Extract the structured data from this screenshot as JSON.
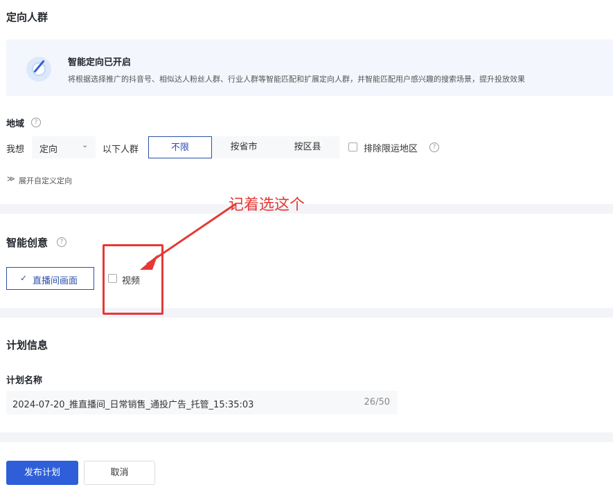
{
  "targeting": {
    "title": "定向人群",
    "banner": {
      "title": "智能定向已开启",
      "desc": "将根据选择推广的抖音号、相似达人粉丝人群、行业人群等智能匹配和扩展定向人群，并智能匹配用户感兴趣的搜索场景，提升投放效果"
    }
  },
  "region": {
    "label": "地域",
    "prefix": "我想",
    "mode_value": "定向",
    "suffix": "以下人群",
    "options": [
      "不限",
      "按省市",
      "按区县"
    ],
    "selected": "不限",
    "exclude_label": "排除限运地区",
    "expand_label": "展开自定义定向"
  },
  "creative": {
    "title": "智能创意",
    "option_live": "直播间画面",
    "option_video": "视频"
  },
  "plan": {
    "title": "计划信息",
    "name_label": "计划名称",
    "name_value": "2024-07-20_推直播间_日常销售_通投广告_托管_15:35:03",
    "counter": "26/50"
  },
  "footer": {
    "publish": "发布计划",
    "cancel": "取消"
  },
  "annotation": {
    "text": "记着选这个",
    "color": "#e53935"
  },
  "colors": {
    "accent": "#2e5fd8",
    "active_border": "#2b4fa8"
  }
}
